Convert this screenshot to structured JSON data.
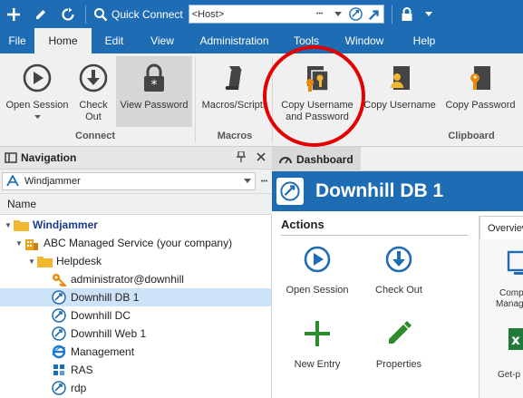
{
  "quick_toolbar": {
    "quick_connect_label": "Quick Connect",
    "host_placeholder": "<Host>",
    "more_glyph": "•••"
  },
  "menu": {
    "items": [
      {
        "label": "File",
        "active": false
      },
      {
        "label": "Home",
        "active": true
      },
      {
        "label": "Edit",
        "active": false
      },
      {
        "label": "View",
        "active": false
      },
      {
        "label": "Administration",
        "active": false
      },
      {
        "label": "Tools",
        "active": false
      },
      {
        "label": "Window",
        "active": false
      },
      {
        "label": "Help",
        "active": false
      }
    ]
  },
  "ribbon": {
    "open_session": "Open Session",
    "check_out_line1": "Check",
    "check_out_line2": "Out",
    "view_password": "View Password",
    "macros_scripts": "Macros/Scripts",
    "copy_username_and_password_line1": "Copy Username",
    "copy_username_and_password_line2": "and Password",
    "copy_username": "Copy Username",
    "copy_password": "Copy Password",
    "groups": {
      "connect": "Connect",
      "macros": "Macros",
      "clipboard": "Clipboard"
    }
  },
  "navigation": {
    "title": "Navigation",
    "pin_glyph": "⮍",
    "close_glyph": "✕",
    "datasource": "Windjammer",
    "more_glyph": "•••",
    "column_name": "Name",
    "tree": [
      {
        "label": "Windjammer",
        "level": 0,
        "icon": "folder-icon",
        "expanded": true,
        "bold": true
      },
      {
        "label": "ABC Managed Service (your company)",
        "level": 1,
        "icon": "building-icon",
        "expanded": true
      },
      {
        "label": "Helpdesk",
        "level": 2,
        "icon": "folder-icon",
        "expanded": true
      },
      {
        "label": "administrator@downhill",
        "level": 3,
        "icon": "key-icon"
      },
      {
        "label": "Downhill DB 1",
        "level": 3,
        "icon": "rdp-icon",
        "selected": true
      },
      {
        "label": "Downhill DC",
        "level": 3,
        "icon": "rdp-icon"
      },
      {
        "label": "Downhill Web 1",
        "level": 3,
        "icon": "rdp-icon"
      },
      {
        "label": "Management",
        "level": 3,
        "icon": "ie-icon"
      },
      {
        "label": "RAS",
        "level": 3,
        "icon": "ras-icon"
      },
      {
        "label": "rdp",
        "level": 3,
        "icon": "rdp-icon"
      }
    ]
  },
  "dashboard": {
    "tab_label": "Dashboard",
    "entry_title": "Downhill DB 1",
    "actions_heading": "Actions",
    "actions": {
      "open_session": "Open Session",
      "check_out": "Check Out",
      "new_entry": "New Entry",
      "properties": "Properties"
    },
    "overview": {
      "tab_label": "Overview",
      "item1_line1": "Comp",
      "item1_line2": "Manag",
      "item2": "Get-p"
    }
  },
  "colors": {
    "brand_blue": "#1e6cb3",
    "selection": "#cde3f7",
    "annotation_red": "#e40000",
    "folder_yellow": "#f0b830",
    "key_orange": "#e8890c",
    "plus_green": "#2e8b2e"
  }
}
